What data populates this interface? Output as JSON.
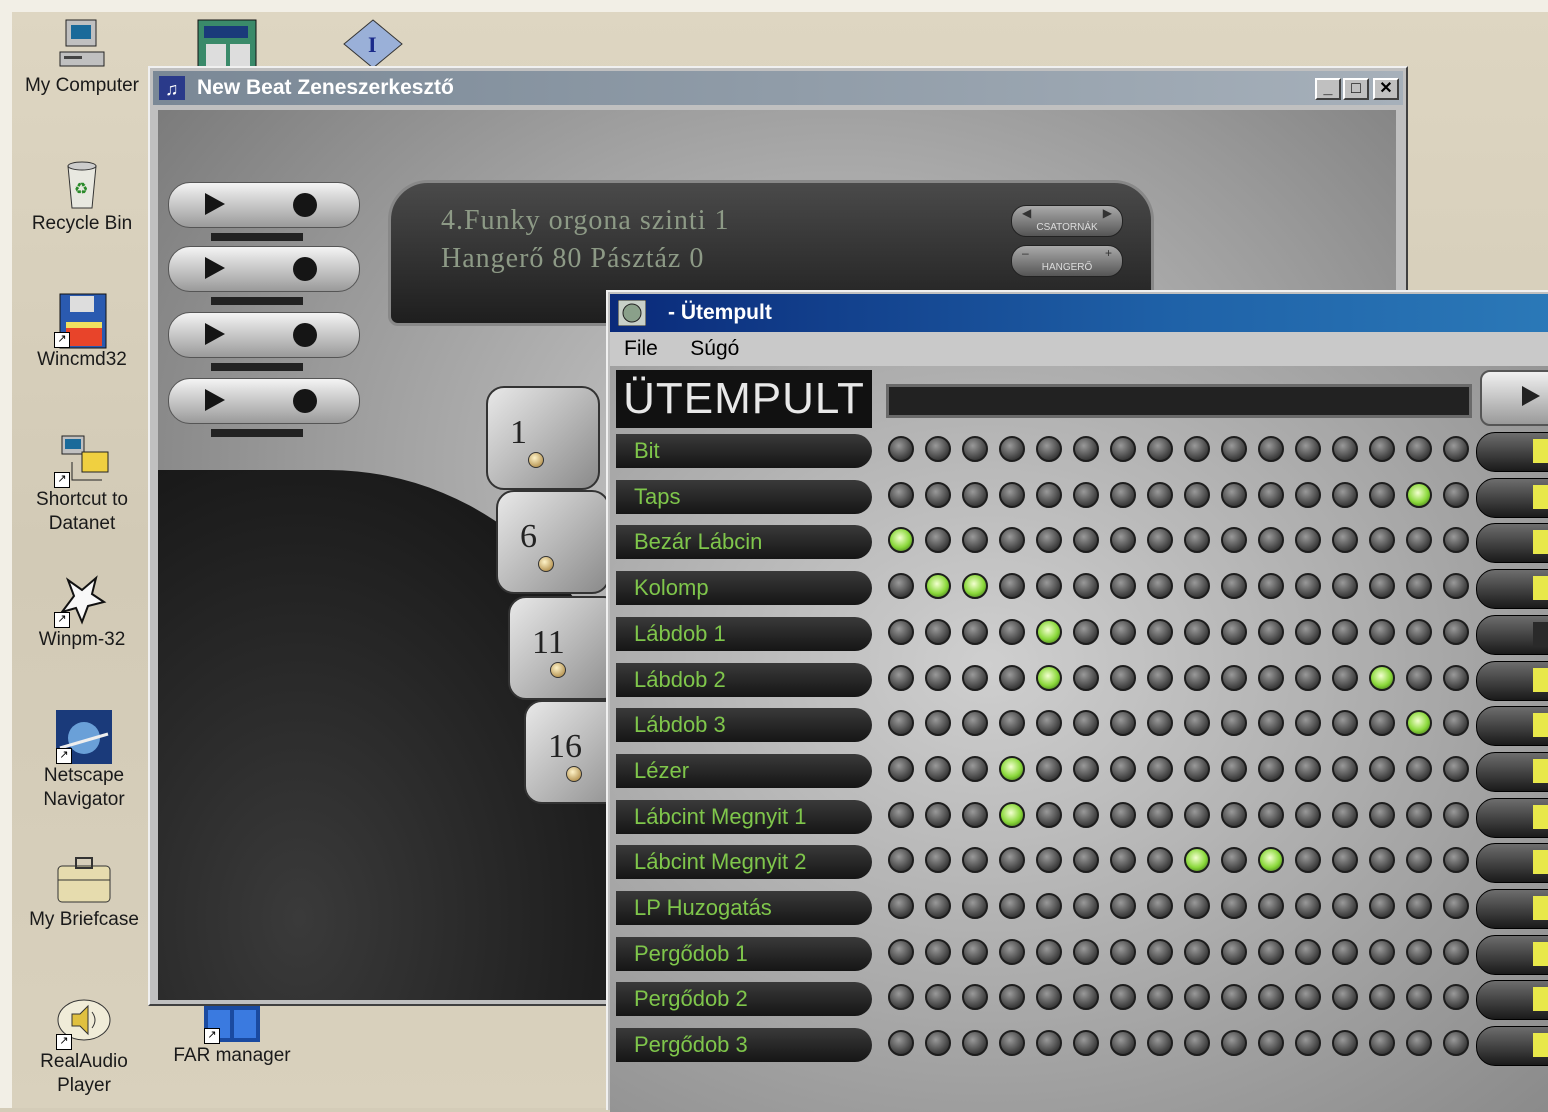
{
  "desktop": {
    "icons": [
      {
        "label": "My Computer",
        "icon": "computer-icon"
      },
      {
        "label": "Recycle Bin",
        "icon": "recycle-bin-icon"
      },
      {
        "label": "Wincmd32",
        "icon": "floppy-icon"
      },
      {
        "label": "Shortcut to\nDatanet",
        "icon": "network-icon"
      },
      {
        "label": "Winpm-32",
        "icon": "pegasus-icon"
      },
      {
        "label": "Netscape\nNavigator",
        "icon": "netscape-icon"
      },
      {
        "label": "My Briefcase",
        "icon": "briefcase-icon"
      },
      {
        "label": "RealAudio\nPlayer",
        "icon": "speaker-icon"
      },
      {
        "label": "FAR manager",
        "icon": "far-manager-icon"
      }
    ]
  },
  "newbeat": {
    "title": "New Beat Zeneszerkesztő",
    "display_line1": "4.Funky orgona szinti 1",
    "display_line2": "Hangerő 80 Pásztáz 0",
    "ctl_channels": "CSATORNÁK",
    "ctl_volume": "HANGERŐ",
    "pads": [
      "1",
      "6",
      "11",
      "16"
    ]
  },
  "utempult": {
    "title": "- Ütempult",
    "menu": [
      "File",
      "Súgó"
    ],
    "logo": "ÜTEMPULT",
    "tracks": [
      {
        "name": "Bit",
        "on": []
      },
      {
        "name": "Taps",
        "on": [
          14
        ]
      },
      {
        "name": "Bezár Lábcin",
        "on": [
          0
        ]
      },
      {
        "name": "Kolomp",
        "on": [
          1,
          2
        ]
      },
      {
        "name": "Lábdob 1",
        "on": [
          4
        ]
      },
      {
        "name": "Lábdob 2",
        "on": [
          4,
          13
        ]
      },
      {
        "name": "Lábdob 3",
        "on": [
          14
        ]
      },
      {
        "name": "Lézer",
        "on": [
          3
        ]
      },
      {
        "name": "Lábcint Megnyit 1",
        "on": [
          3
        ]
      },
      {
        "name": "Lábcint Megnyit 2",
        "on": [
          8,
          10
        ]
      },
      {
        "name": "LP Huzogatás",
        "on": []
      },
      {
        "name": "Pergődob 1",
        "on": []
      },
      {
        "name": "Pergődob 2",
        "on": []
      },
      {
        "name": "Pergődob 3",
        "on": []
      }
    ],
    "steps_visible": 16,
    "muted_rows": [
      4
    ],
    "accent_on": "#8ad83a"
  }
}
